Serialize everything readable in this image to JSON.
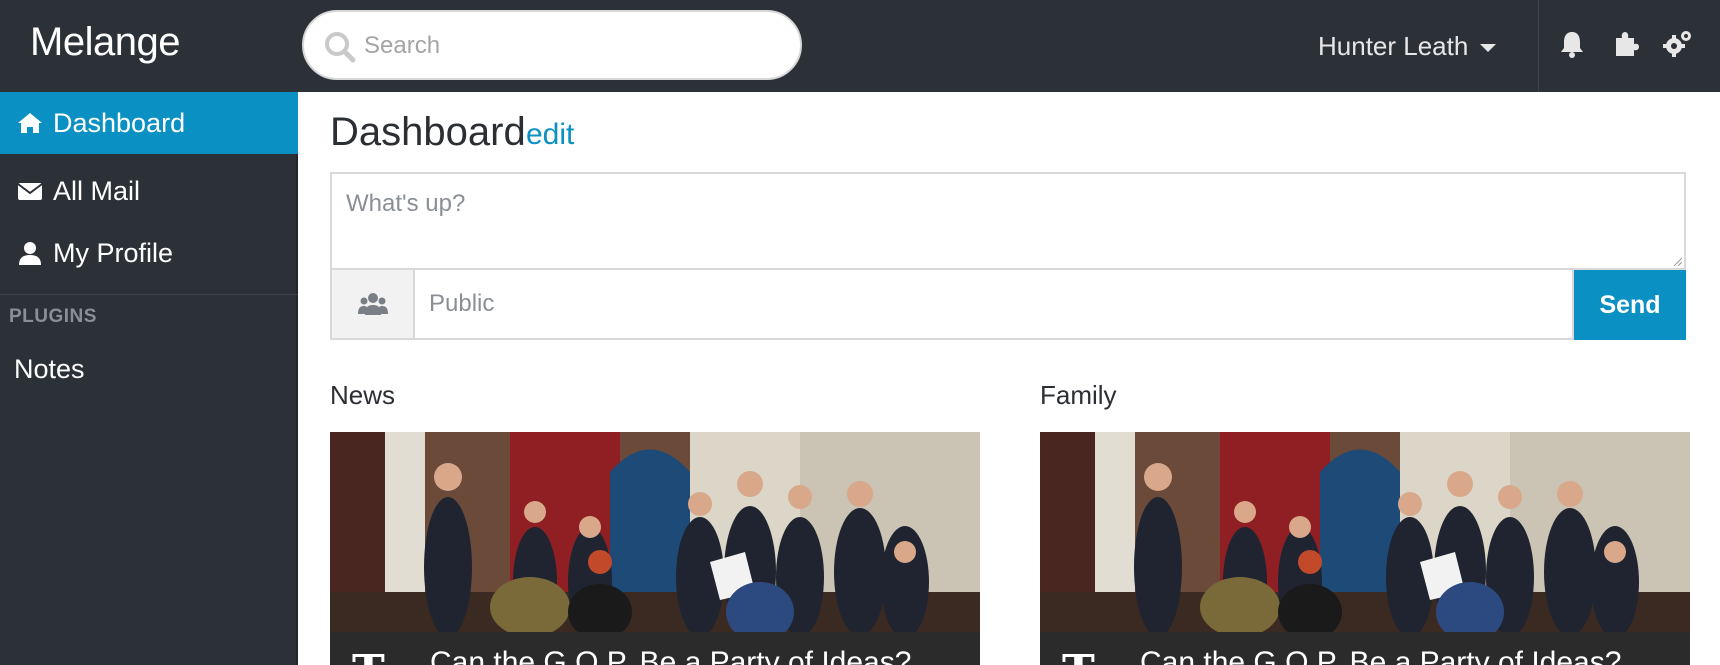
{
  "app": {
    "brand": "Melange"
  },
  "header": {
    "search_placeholder": "Search",
    "user_name": "Hunter Leath",
    "icons": [
      "bell-icon",
      "puzzle-icon",
      "cogs-icon"
    ]
  },
  "sidebar": {
    "items": [
      {
        "label": "Dashboard",
        "icon": "home-icon",
        "active": true
      },
      {
        "label": "All Mail",
        "icon": "envelope-icon",
        "active": false
      },
      {
        "label": "My Profile",
        "icon": "user-icon",
        "active": false
      }
    ],
    "plugins_header": "PLUGINS",
    "plugins": [
      {
        "label": "Notes"
      }
    ]
  },
  "main": {
    "title": "Dashboard",
    "edit_label": "edit",
    "composer": {
      "placeholder": "What's up?",
      "audience_placeholder": "Public",
      "audience_icon": "group-icon",
      "send_label": "Send"
    },
    "sections": [
      {
        "title": "News",
        "card": {
          "source_logo": "T",
          "headline": "Can the G.O.P. Be a Party of Ideas?"
        }
      },
      {
        "title": "Family",
        "card": {
          "source_logo": "T",
          "headline": "Can the G.O.P. Be a Party of Ideas?"
        }
      }
    ]
  },
  "colors": {
    "topbar": "#2c3037",
    "accent": "#0b90c3",
    "sidebar": "#2c3037"
  }
}
